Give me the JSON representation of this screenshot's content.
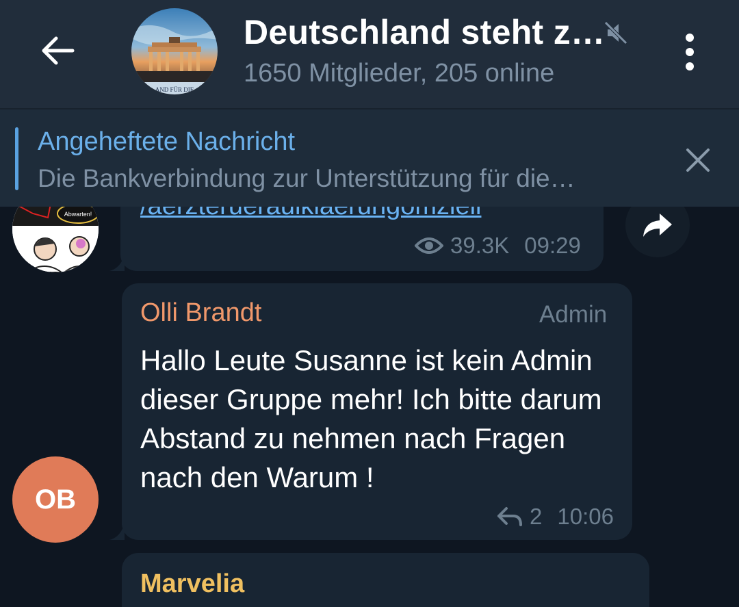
{
  "header": {
    "title": "Deutschland steht z…",
    "subtitle": "1650 Mitglieder, 205 online",
    "avatar_caption": "AND FÜR DIE"
  },
  "pinned": {
    "title": "Angeheftete Nachricht",
    "text": "Die Bankverbindung zur Unterstützung für die…"
  },
  "messages": [
    {
      "link": "/aerzteruerauiklaerungomzieli",
      "avatar_caption": "Abwarten!",
      "views": "39.3K",
      "time": "09:29"
    },
    {
      "sender": "Olli Brandt",
      "badge": "Admin",
      "avatar_initials": "OB",
      "text": "Hallo Leute Susanne ist kein Admin dieser Gruppe mehr! Ich bitte darum Abstand zu nehmen nach Fragen nach den Warum !",
      "replies": "2",
      "time": "10:06"
    },
    {
      "sender": "Marvelia"
    }
  ],
  "colors": {
    "background": "#0e1621",
    "header": "#212d3b",
    "bubble": "#182533",
    "accent": "#6bb0ea",
    "sender_olli": "#f0986b",
    "sender_marvelia": "#f0c060",
    "ob_avatar": "#e07b58"
  },
  "icons": [
    "back-arrow-icon",
    "mute-icon",
    "more-vert-icon",
    "close-icon",
    "eye-icon",
    "share-icon",
    "reply-icon"
  ]
}
